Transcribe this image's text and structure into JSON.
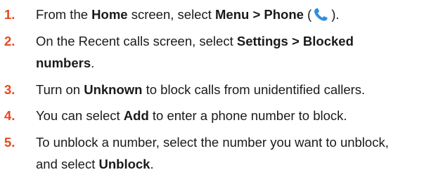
{
  "steps": [
    {
      "number": "1.",
      "parts": [
        "From the ",
        "Home",
        " screen, select ",
        "Menu > Phone",
        " (",
        ")."
      ]
    },
    {
      "number": "2.",
      "parts": [
        "On the Recent calls screen, select ",
        "Settings > Blocked",
        "numbers",
        "."
      ]
    },
    {
      "number": "3.",
      "parts": [
        "Turn on ",
        "Unknown",
        " to block calls from unidentified callers."
      ]
    },
    {
      "number": "4.",
      "parts": [
        "You can select ",
        "Add",
        " to enter a phone number to block."
      ]
    },
    {
      "number": "5.",
      "parts": [
        "To unblock a number, select the number you want to unblock,",
        "and select ",
        "Unblock",
        "."
      ]
    }
  ],
  "icons": {
    "phone": "phone-icon",
    "phone_color": "#2f8fdc"
  },
  "colors": {
    "number": "#e8481e",
    "text": "#1a1a1a"
  }
}
